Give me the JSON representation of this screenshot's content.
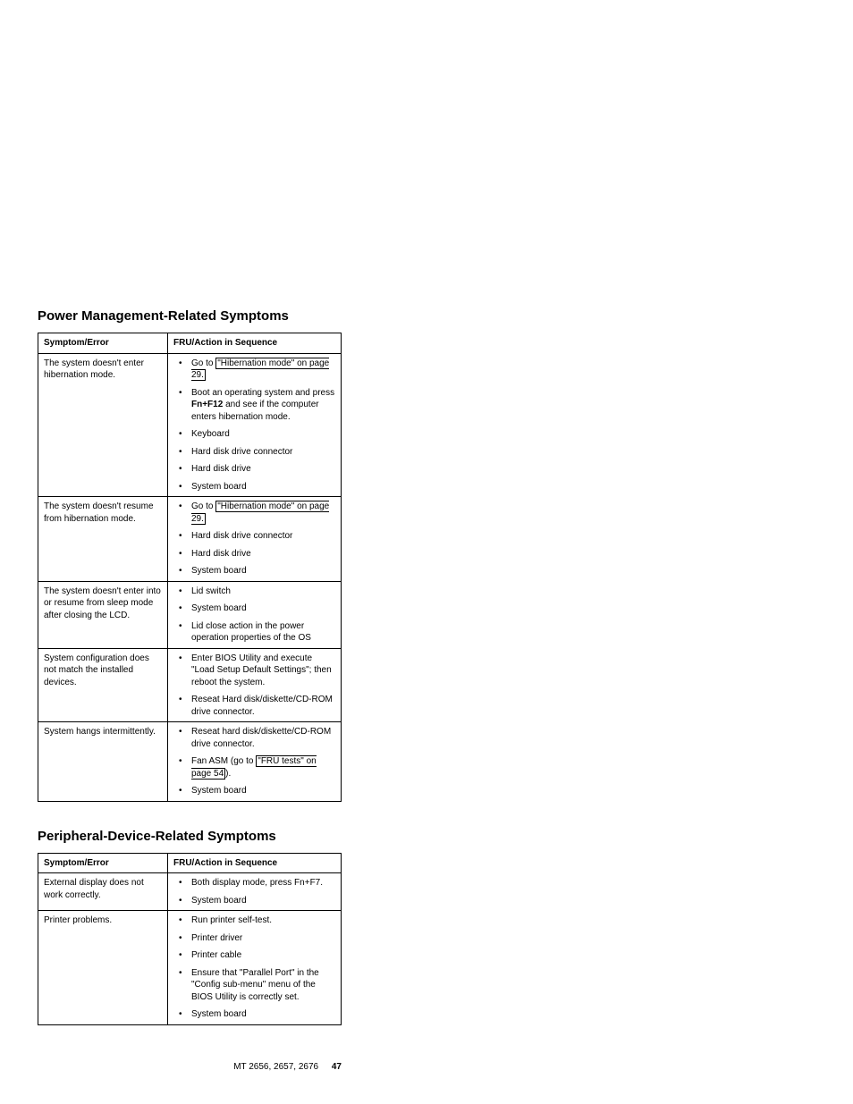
{
  "section1": {
    "heading": "Power Management-Related Symptoms",
    "col1": "Symptom/Error",
    "col2": "FRU/Action in Sequence",
    "rows": [
      {
        "symptom": "The system doesn't enter hibernation mode.",
        "a1_pre": "Go to ",
        "a1_link": "\"Hibernation mode\" on page 29.",
        "a2_pre": "Boot an operating system and press ",
        "a2_bold": "Fn+F12",
        "a2_post": " and see if the computer enters hibernation mode.",
        "a3": "Keyboard",
        "a4": "Hard disk drive connector",
        "a5": "Hard disk drive",
        "a6": "System board"
      },
      {
        "symptom": "The system doesn't resume from hibernation mode.",
        "a1_pre": "Go to ",
        "a1_link": "\"Hibernation mode\" on page 29.",
        "a2": "Hard disk drive connector",
        "a3": "Hard disk drive",
        "a4": "System board"
      },
      {
        "symptom": "The system doesn't enter into or resume from sleep mode after closing the LCD.",
        "a1": "Lid switch",
        "a2": "System board",
        "a3": "Lid close action in the power operation properties of the OS"
      },
      {
        "symptom": "System configuration does not match the installed devices.",
        "a1": "Enter BIOS Utility and execute \"Load Setup Default Settings\"; then reboot the system.",
        "a2": "Reseat Hard disk/diskette/CD-ROM drive connector."
      },
      {
        "symptom": "System hangs intermittently.",
        "a1": "Reseat hard disk/diskette/CD-ROM drive connector.",
        "a2_pre": "Fan ASM (go to ",
        "a2_link": "\"FRU tests\" on page 54",
        "a2_post": ").",
        "a3": "System board"
      }
    ]
  },
  "section2": {
    "heading": "Peripheral-Device-Related Symptoms",
    "col1": "Symptom/Error",
    "col2": "FRU/Action in Sequence",
    "rows": [
      {
        "symptom": "External display does not work correctly.",
        "a1": "Both display mode, press Fn+F7.",
        "a2": "System board"
      },
      {
        "symptom": "Printer problems.",
        "a1": "Run printer self-test.",
        "a2": "Printer driver",
        "a3": "Printer cable",
        "a4": "Ensure that \"Parallel Port\" in the \"Config sub-menu\" menu of the BIOS Utility is correctly set.",
        "a5": "System board"
      }
    ]
  },
  "footer": {
    "text": "MT 2656, 2657, 2676",
    "page": "47"
  }
}
